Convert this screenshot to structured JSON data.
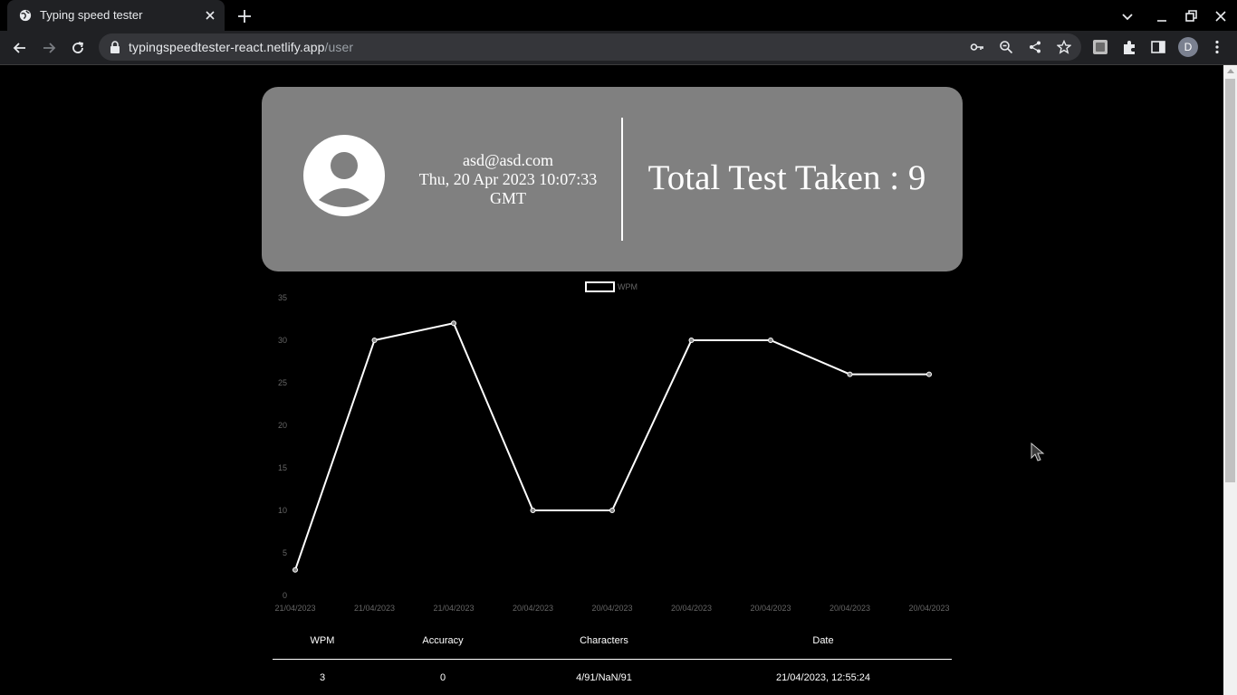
{
  "browser": {
    "tab_title": "Typing speed tester",
    "url_host": "typingspeedtester-react.netlify.app",
    "url_path": "/user",
    "profile_initial": "D"
  },
  "profile": {
    "email": "asd@asd.com",
    "date_line1": "Thu, 20 Apr 2023 10:07:33",
    "date_line2": "GMT",
    "total_tests": "Total Test Taken : 9"
  },
  "chart_data": {
    "type": "line",
    "categories": [
      "21/04/2023",
      "21/04/2023",
      "21/04/2023",
      "20/04/2023",
      "20/04/2023",
      "20/04/2023",
      "20/04/2023",
      "20/04/2023",
      "20/04/2023"
    ],
    "series": [
      {
        "name": "WPM",
        "values": [
          3,
          30,
          32,
          10,
          10,
          30,
          30,
          26,
          26
        ]
      }
    ],
    "ylim": [
      0,
      35
    ],
    "yticks": [
      "0",
      "5",
      "10",
      "15",
      "20",
      "25",
      "30",
      "35"
    ],
    "grid": false,
    "legend": "top-center",
    "line_color": "#ffffff"
  },
  "table": {
    "headers": [
      "WPM",
      "Accuracy",
      "Characters",
      "Date"
    ],
    "rows": [
      [
        "3",
        "0",
        "4/91/NaN/91",
        "21/04/2023, 12:55:24"
      ]
    ]
  }
}
